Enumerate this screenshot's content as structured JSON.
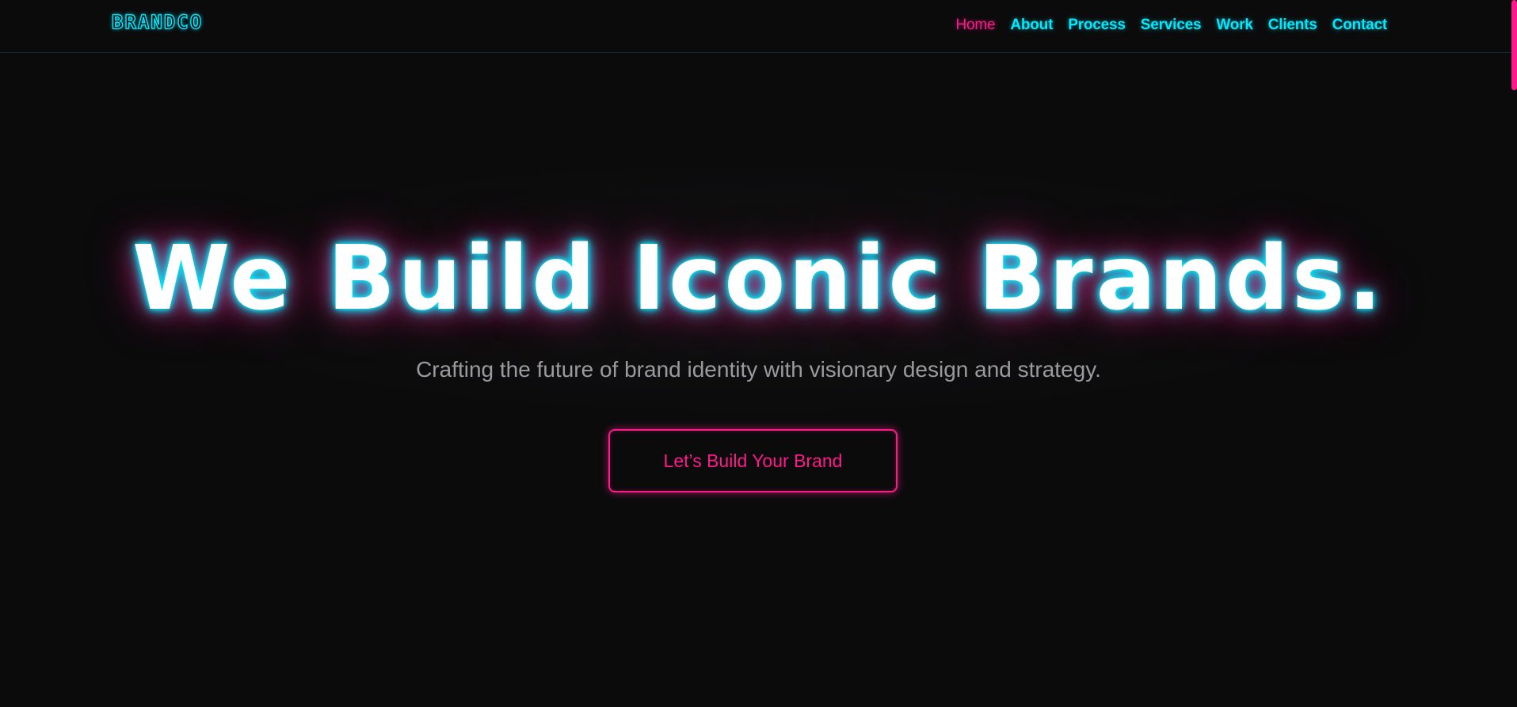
{
  "header": {
    "logo": "BRANDCO",
    "nav": [
      {
        "label": "Home",
        "active": true
      },
      {
        "label": "About",
        "active": false
      },
      {
        "label": "Process",
        "active": false
      },
      {
        "label": "Services",
        "active": false
      },
      {
        "label": "Work",
        "active": false
      },
      {
        "label": "Clients",
        "active": false
      },
      {
        "label": "Contact",
        "active": false
      }
    ]
  },
  "hero": {
    "title": "We Build Iconic Brands.",
    "subtitle": "Crafting the future of brand identity with visionary design and strategy.",
    "cta_label": "Let’s Build Your Brand"
  },
  "colors": {
    "background": "#0b0b0c",
    "accent_cyan": "#00eaff",
    "accent_pink": "#ff1a8c",
    "muted_text": "#9a9a9f"
  }
}
